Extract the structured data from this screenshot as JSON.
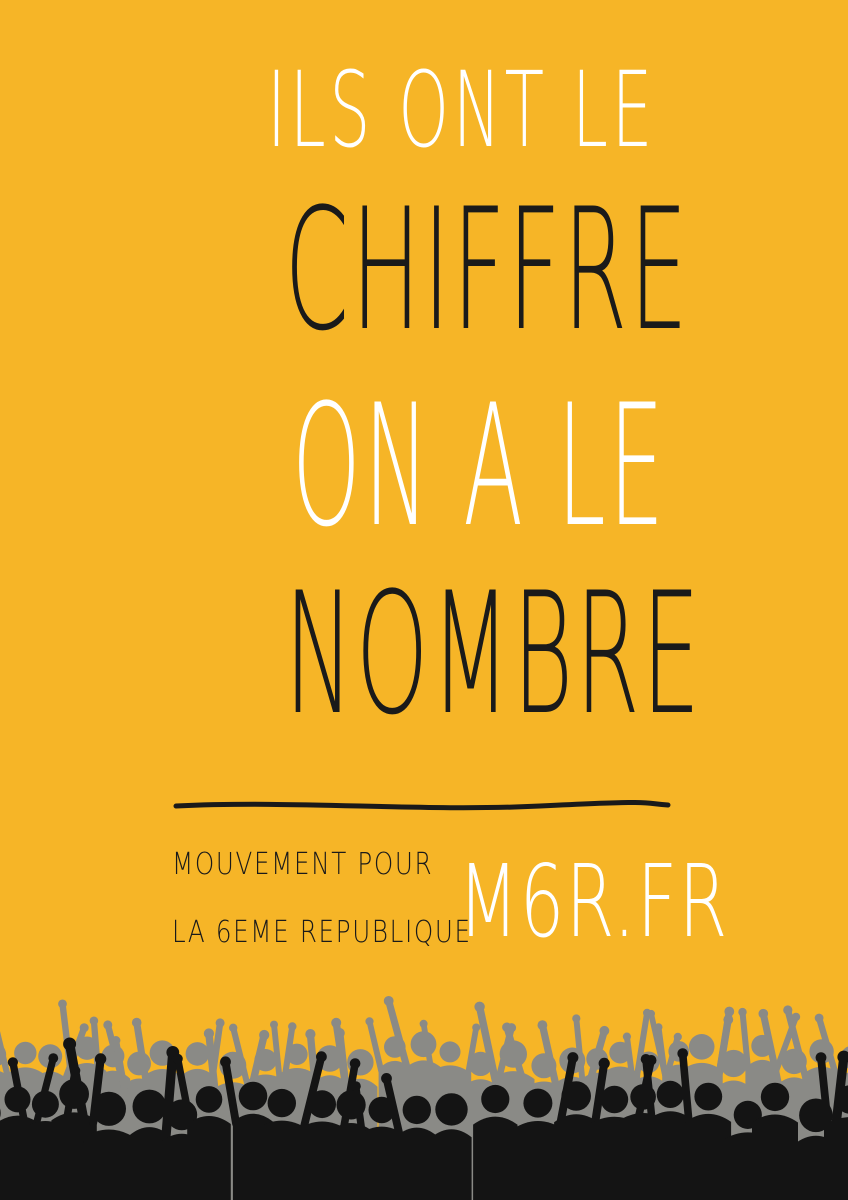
{
  "colors": {
    "background": "#f6b527",
    "white_text": "#ffffff",
    "black_text": "#1a1a1a",
    "crowd_back": "#8a8a86",
    "crowd_front": "#141414"
  },
  "headline": {
    "line1": "ILS ONT LE",
    "line2": "CHIFFRE",
    "line3": "ON A LE",
    "line4": "NOMBRE"
  },
  "footer": {
    "movement_line1": "MOUVEMENT POUR",
    "movement_line2": "LA 6EME REPUBLIQUE",
    "website": "M6R.FR"
  },
  "graphics": {
    "divider": "hand-drawn-underline",
    "crowd": "cheering-crowd-silhouette"
  }
}
